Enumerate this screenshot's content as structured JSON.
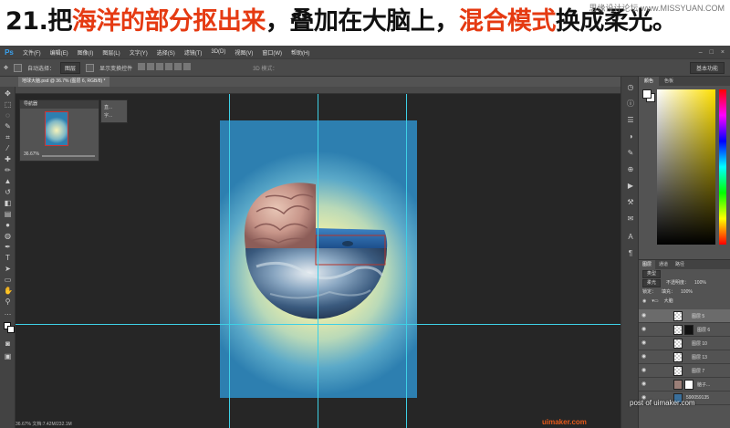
{
  "banner": {
    "step": "21.",
    "part1": "把",
    "part2": "海洋的部分抠出来",
    "part3": "，叠加在大脑上，",
    "part4": "混合模式",
    "part5": "换成柔光。",
    "watermark": "思缘设计论坛 www.MISSYUAN.COM"
  },
  "menubar": {
    "logo": "Ps",
    "items": [
      "文件(F)",
      "编辑(E)",
      "图像(I)",
      "图层(L)",
      "文字(Y)",
      "选择(S)",
      "滤镜(T)",
      "3D(D)",
      "视图(V)",
      "窗口(W)",
      "帮助(H)"
    ]
  },
  "optionsbar": {
    "auto_select_label": "自动选择：",
    "auto_select_value": "图层",
    "show_transform": "显示变换控件",
    "mode_3d": "3D 模式：",
    "workspace": "基本功能"
  },
  "document_tab": {
    "label": "地球大脑.psd @ 36.7% (图层 6, RGB/8) *"
  },
  "navigator": {
    "title": "导航器",
    "zoom": "36.67%",
    "side_items": [
      "直...",
      "字..."
    ]
  },
  "color_panel": {
    "tabs": [
      "颜色",
      "色板"
    ],
    "foreground": "#ffffff",
    "background": "#ffffff"
  },
  "layers_panel": {
    "tabs": [
      "图层",
      "通道",
      "路径"
    ],
    "filter": "类型",
    "blend_mode": "柔光",
    "opacity_label": "不透明度：",
    "opacity": "100%",
    "lock_label": "锁定：",
    "fill_label": "填充：",
    "fill": "100%",
    "group_name": "大脑",
    "layers": [
      {
        "name": "图层 5",
        "selected": true
      },
      {
        "name": "图层 6",
        "selected": false
      },
      {
        "name": "图层 10",
        "selected": false
      },
      {
        "name": "图层 13",
        "selected": false
      },
      {
        "name": "图层 7",
        "selected": false
      },
      {
        "name": "脑子...",
        "selected": false
      },
      {
        "name": "590059135",
        "selected": false
      }
    ]
  },
  "footer": {
    "watermark": "post of uimaker.com",
    "logo": "uimaker.com",
    "status": "36.67%    文档:7.42M/232.1M"
  },
  "colors": {
    "accent_red": "#e53a12",
    "guide": "#3ed0e6",
    "ps_blue": "#3aa2f0"
  }
}
